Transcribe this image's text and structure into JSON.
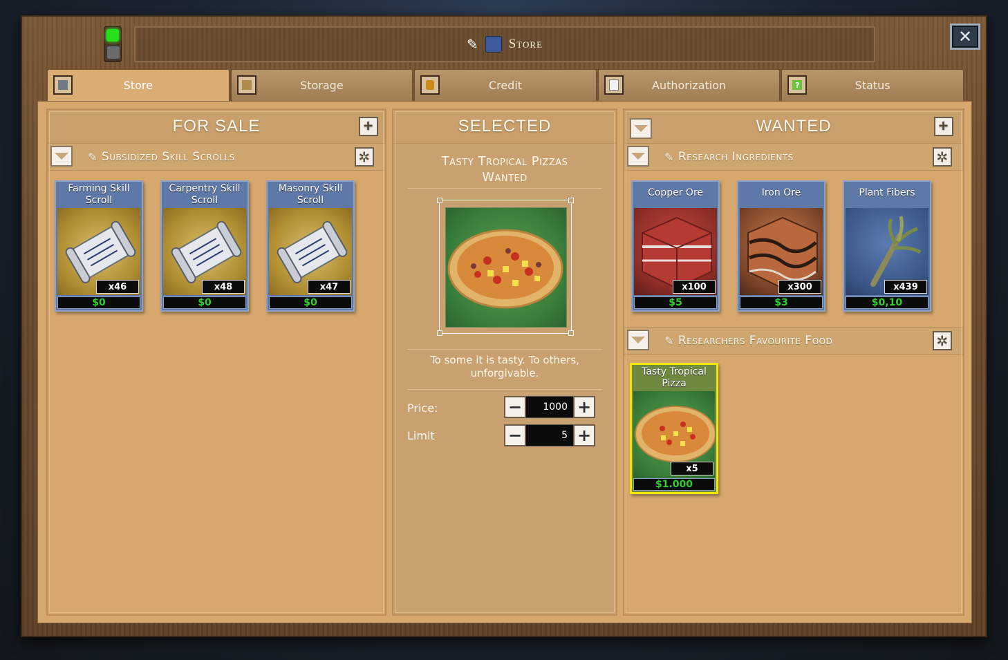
{
  "window": {
    "title": "Store",
    "close_label": "✕"
  },
  "tabs": [
    {
      "label": "Store",
      "icon": "crate-gray-icon",
      "active": true
    },
    {
      "label": "Storage",
      "icon": "box-icon"
    },
    {
      "label": "Credit",
      "icon": "coin-icon"
    },
    {
      "label": "Authorization",
      "icon": "document-icon"
    },
    {
      "label": "Status",
      "icon": "question-icon"
    }
  ],
  "for_sale": {
    "header": "FOR SALE",
    "category": "Subsidized Skill Scrolls",
    "items": [
      {
        "name": "Farming Skill Scroll",
        "qty": "x46",
        "price": "$0"
      },
      {
        "name": "Carpentry Skill Scroll",
        "qty": "x48",
        "price": "$0"
      },
      {
        "name": "Masonry Skill Scroll",
        "qty": "x47",
        "price": "$0"
      }
    ]
  },
  "selected": {
    "header": "SELECTED",
    "title_line1": "Tasty Tropical Pizzas",
    "title_line2": "Wanted",
    "description": "To some it is tasty. To others, unforgivable.",
    "price_label": "Price:",
    "price_value": "1000",
    "limit_label": "Limit",
    "limit_value": "5"
  },
  "wanted": {
    "header": "WANTED",
    "category1": "Research Ingredients",
    "items1": [
      {
        "name": "Copper Ore",
        "qty": "x100",
        "price": "$5"
      },
      {
        "name": "Iron Ore",
        "qty": "x300",
        "price": "$3"
      },
      {
        "name": "Plant Fibers",
        "qty": "x439",
        "price": "$0,10"
      }
    ],
    "category2": "Researchers Favourite Food",
    "items2": [
      {
        "name": "Tasty Tropical Pizza",
        "qty": "x5",
        "price": "$1.000"
      }
    ]
  },
  "colors": {
    "price_green": "#30d02a",
    "highlight_yellow": "#f1e800",
    "status_led": "#26e01c"
  }
}
